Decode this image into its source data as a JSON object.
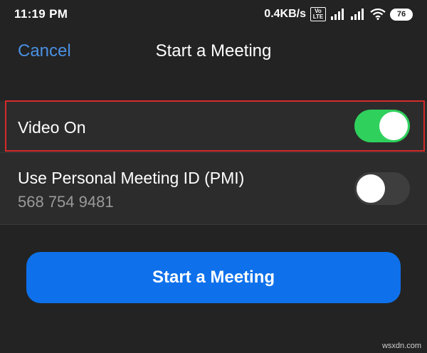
{
  "status_bar": {
    "time": "11:19 PM",
    "network_speed": "0.4KB/s",
    "volte_top": "Vo",
    "volte_bottom": "LTE",
    "battery_level": "76",
    "icons": [
      "volte-icon",
      "signal-icon",
      "signal-icon",
      "wifi-icon",
      "battery-icon"
    ]
  },
  "nav": {
    "cancel_label": "Cancel",
    "title": "Start a Meeting"
  },
  "settings": {
    "video": {
      "label": "Video On",
      "enabled": true
    },
    "pmi": {
      "label": "Use Personal Meeting ID (PMI)",
      "id": "568 754 9481",
      "enabled": false
    }
  },
  "actions": {
    "start_label": "Start a Meeting"
  },
  "watermark": "wsxdn.com",
  "colors": {
    "background": "#232323",
    "row_background": "#2c2c2c",
    "accent_link": "#4a90e2",
    "primary_button": "#0e71eb",
    "toggle_on": "#2fd05c",
    "toggle_off": "#3e3e3e",
    "highlight_border": "#d42a2a"
  }
}
